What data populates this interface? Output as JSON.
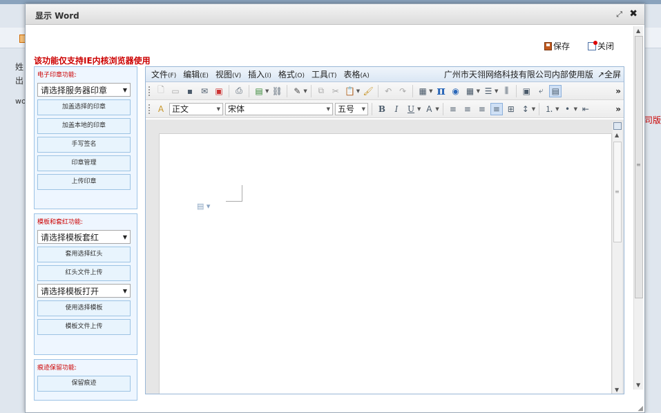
{
  "background": {
    "left_texts": [
      "姓",
      "出",
      "wo"
    ],
    "right_text": "公司版"
  },
  "dialog": {
    "title": "显示  Word",
    "restore_icon": "⤢",
    "close_icon": "✖"
  },
  "actions": {
    "save_label": "保存",
    "close_label": "关闭"
  },
  "warning": "该功能仅支持IE内核浏览器使用",
  "panels": {
    "seal": {
      "title": "电子印章功能:",
      "select": "请选择服务器印章",
      "buttons": [
        "加盖选择的印章",
        "加盖本地的印章",
        "手写签名",
        "印章管理",
        "上传印章"
      ]
    },
    "template": {
      "title": "模板和套红功能:",
      "select1": "请选择模板套红",
      "button1": "套用选择红头",
      "button2": "红头文件上传",
      "select2": "请选择模板打开",
      "button3": "使用选择模板",
      "button4": "模板文件上传"
    },
    "trace": {
      "title": "痕迹保留功能:",
      "button": "保留痕迹"
    }
  },
  "editor": {
    "menus": [
      {
        "label": "文件",
        "key": "(F)"
      },
      {
        "label": "编辑",
        "key": "(E)"
      },
      {
        "label": "视图",
        "key": "(V)"
      },
      {
        "label": "插入",
        "key": "(I)"
      },
      {
        "label": "格式",
        "key": "(O)"
      },
      {
        "label": "工具",
        "key": "(T)"
      },
      {
        "label": "表格",
        "key": "(A)"
      }
    ],
    "company": "广州市天翎网络科技有限公司内部使用版",
    "fullscreen": "↗全屏",
    "style_value": "正文",
    "font_value": "宋体",
    "size_value": "五号",
    "more": "»"
  },
  "colors": {
    "warning": "#cc0000",
    "panel_bg": "#eef6ff",
    "panel_border": "#9dc3e6",
    "menubar": "#dbe7f4"
  }
}
